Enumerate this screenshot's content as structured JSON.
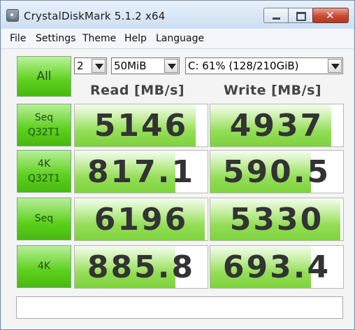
{
  "window": {
    "title": "CrystalDiskMark 5.1.2 x64",
    "controls": {
      "minimize": "minimize",
      "maximize": "maximize",
      "close": "close"
    }
  },
  "menu": [
    "File",
    "Settings",
    "Theme",
    "Help",
    "Language"
  ],
  "toolbar": {
    "all_label": "All",
    "runs": "2",
    "size": "50MiB",
    "drive": "C: 61% (128/210GiB)"
  },
  "columns": {
    "read": "Read [MB/s]",
    "write": "Write [MB/s]"
  },
  "rows": [
    {
      "label1": "Seq",
      "label2": "Q32T1",
      "read": "5146",
      "write": "4937",
      "read_fill": 0.91,
      "write_fill": 0.91
    },
    {
      "label1": "4K",
      "label2": "Q32T1",
      "read": "817.1",
      "write": "590.5",
      "read_fill": 0.76,
      "write_fill": 0.76
    },
    {
      "label1": "Seq",
      "label2": "",
      "read": "6196",
      "write": "5330",
      "read_fill": 0.98,
      "write_fill": 0.98
    },
    {
      "label1": "4K",
      "label2": "",
      "read": "885.8",
      "write": "693.4",
      "read_fill": 0.76,
      "write_fill": 0.76
    }
  ],
  "status_text": "",
  "colors": {
    "accent_green": "#5ed11e",
    "value_text": "#333333"
  }
}
